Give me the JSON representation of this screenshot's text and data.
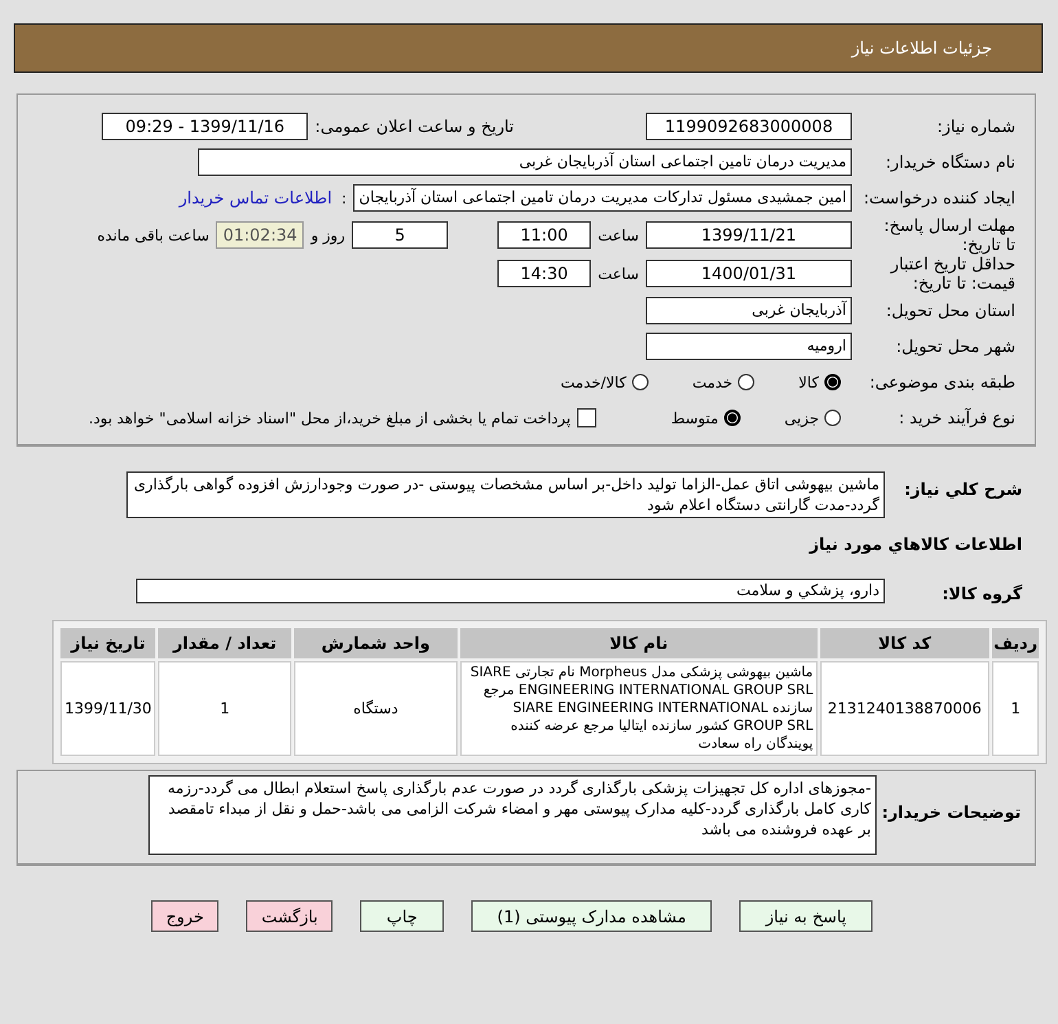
{
  "header": {
    "title": "جزئیات اطلاعات نیاز"
  },
  "details": {
    "need_number": {
      "label": "شماره نیاز:",
      "value": "1199092683000008"
    },
    "announce": {
      "label": "تاریخ و ساعت اعلان عمومی:",
      "value": "1399/11/16 - 09:29"
    },
    "buyer_org": {
      "label": "نام دستگاه خریدار:",
      "value": "مدیریت درمان تامین اجتماعی استان آذربایجان غربی"
    },
    "requester": {
      "label": "ایجاد کننده درخواست:",
      "value": "امین جمشیدی مسئول تدارکات مدیریت درمان تامین اجتماعی استان آذربایجان",
      "separator": ":",
      "contact_link": "اطلاعات تماس خریدار"
    },
    "deadline": {
      "label": "مهلت ارسال پاسخ:\nتا تاریخ:",
      "date": "1399/11/21",
      "time_label": "ساعت",
      "time": "11:00",
      "days": "5",
      "days_label": "روز و",
      "remaining": "01:02:34",
      "remaining_label": "ساعت باقی مانده"
    },
    "validity": {
      "label": "حداقل تاریخ اعتبار\nقیمت: تا تاریخ:",
      "date": "1400/01/31",
      "time_label": "ساعت",
      "time": "14:30"
    },
    "province": {
      "label": "استان محل تحویل:",
      "value": "آذربایجان غربی"
    },
    "city": {
      "label": "شهر محل تحویل:",
      "value": "ارومیه"
    },
    "category": {
      "label": "طبقه بندی موضوعی:",
      "options": [
        {
          "label": "کالا",
          "selected": true
        },
        {
          "label": "خدمت",
          "selected": false
        },
        {
          "label": "کالا/خدمت",
          "selected": false
        }
      ]
    },
    "process": {
      "label": "نوع فرآیند خرید :",
      "options": [
        {
          "label": "جزیی",
          "selected": false
        },
        {
          "label": "متوسط",
          "selected": true
        }
      ],
      "treasury": {
        "label": "پرداخت تمام یا بخشی از مبلغ خرید،از محل \"اسناد خزانه اسلامی\" خواهد بود.",
        "checked": false
      }
    }
  },
  "description": {
    "label": "شرح کلي نياز:",
    "text": "ماشین بیهوشی اتاق عمل-الزاما تولید داخل-بر اساس مشخصات پیوستی -در صورت وجودارزش افزوده گواهی بارگذاری گردد-مدت گارانتی دستگاه اعلام شود"
  },
  "goods_heading": "اطلاعات کالاهاي مورد نياز",
  "goods_group": {
    "label": "گروه کالا:",
    "value": "دارو، پزشکي و سلامت"
  },
  "table": {
    "columns": [
      "ردیف",
      "کد کالا",
      "نام کالا",
      "واحد شمارش",
      "تعداد / مقدار",
      "تاریخ نیاز"
    ],
    "rows": [
      [
        "1",
        "2131240138870006",
        "ماشین بیهوشی پزشکی مدل Morpheus نام تجارتی SIARE ENGINEERING INTERNATIONAL GROUP SRL مرجع سازنده SIARE ENGINEERING INTERNATIONAL GROUP SRL کشور سازنده ایتالیا مرجع عرضه کننده پویندگان راه سعادت",
        "دستگاه",
        "1",
        "1399/11/30"
      ]
    ]
  },
  "buyer_notes": {
    "label": "توضیحات خریدار:",
    "text": "-مجوزهای اداره کل تجهیزات پزشکی بارگذاری گردد در صورت عدم بارگذاری پاسخ استعلام ابطال می گردد-رزمه کاری کامل بارگذاری گردد-کلیه مدارک پیوستی مهر و امضاء شرکت الزامی می باشد-حمل و نقل از مبداء تامقصد بر عهده فروشنده می باشد"
  },
  "buttons": [
    {
      "label": "پاسخ به نیاز",
      "kind": "normal"
    },
    {
      "label": "مشاهده مدارک پیوستی (1)",
      "kind": "normal"
    },
    {
      "label": "چاپ",
      "kind": "normal"
    },
    {
      "label": "بازگشت",
      "kind": "danger"
    },
    {
      "label": "خروج",
      "kind": "danger"
    }
  ]
}
